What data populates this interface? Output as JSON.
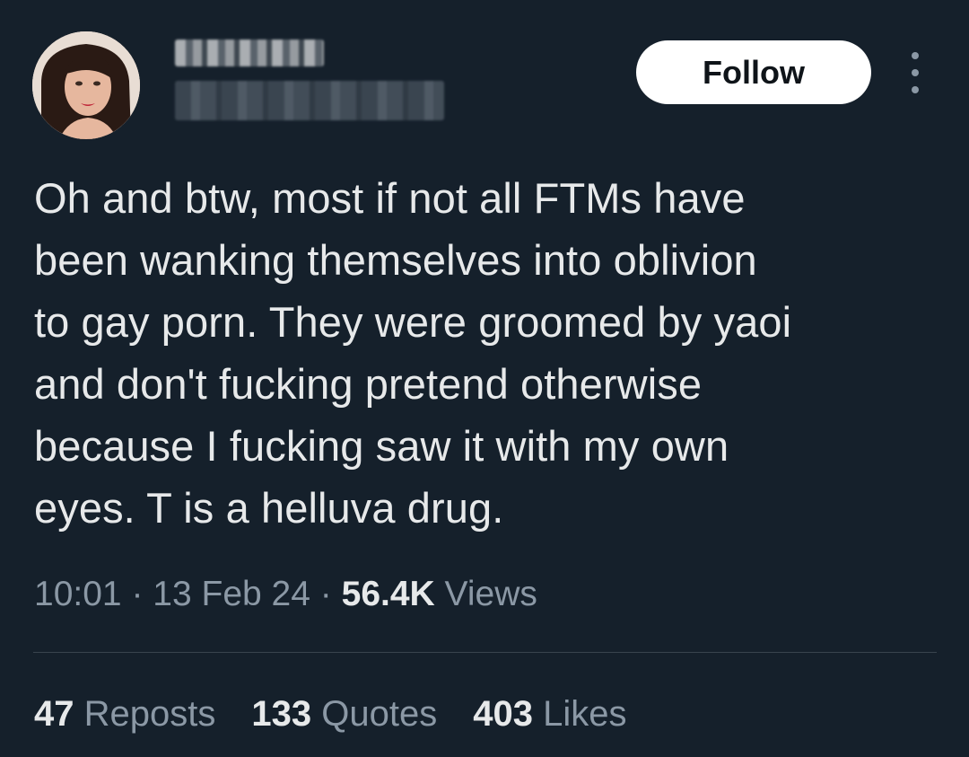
{
  "header": {
    "follow_label": "Follow"
  },
  "tweet": {
    "text": "Oh and btw, most if not all FTMs have\nbeen wanking themselves into oblivion\nto gay porn. They were groomed by yaoi\nand don't fucking pretend otherwise\nbecause I fucking saw it with my own\neyes. T is a helluva drug."
  },
  "meta": {
    "time": "10:01",
    "separator": "·",
    "date": "13 Feb 24",
    "views_count": "56.4K",
    "views_label": "Views"
  },
  "stats": {
    "reposts_count": "47",
    "reposts_label": "Reposts",
    "quotes_count": "133",
    "quotes_label": "Quotes",
    "likes_count": "403",
    "likes_label": "Likes"
  },
  "colors": {
    "background": "#15202b",
    "text_primary": "#e7e9ea",
    "text_secondary": "#8b98a5",
    "divider": "#38444d",
    "follow_button_bg": "#ffffff"
  },
  "icons": {
    "more": "more-dots-vertical-icon"
  }
}
